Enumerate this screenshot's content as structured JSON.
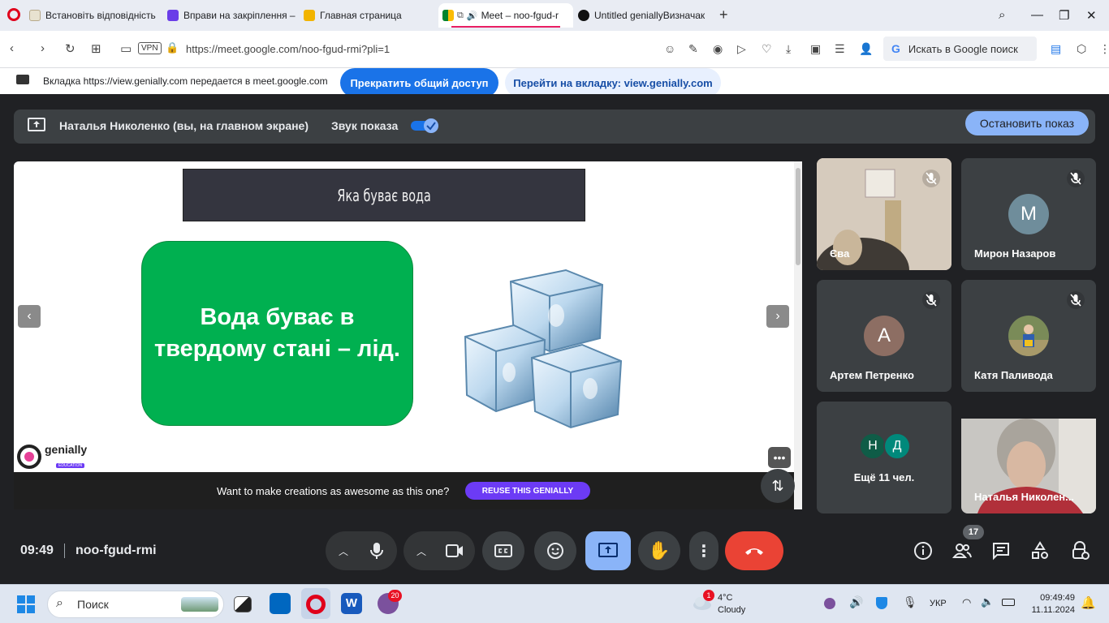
{
  "browser": {
    "tabs": [
      {
        "label": "Встановіть відповідність",
        "icon": "pencil-doc-icon"
      },
      {
        "label": "Вправи на закріплення –",
        "icon": "wordwall-icon"
      },
      {
        "label": "Главная страница",
        "icon": "profile-card-icon"
      },
      {
        "label": "Meet – noo-fgud-r",
        "icon": "meet-icon"
      },
      {
        "label": "Untitled geniallyВизначак",
        "icon": "genially-icon"
      }
    ],
    "url": "https://meet.google.com/noo-fgud-rmi?pli=1",
    "vpn_label": "VPN",
    "search_placeholder": "Искать в Google поиск"
  },
  "share_notice": {
    "text": "Вкладка https://view.genially.com передается в meet.google.com",
    "stop_button": "Прекратить общий доступ",
    "goto_button": "Перейти на вкладку: view.genially.com"
  },
  "presentation_bar": {
    "presenter": "Наталья Николенко (вы, на главном экране)",
    "sound_label": "Звук показа",
    "stop_button": "Остановить показ"
  },
  "slide": {
    "title": "Яка буває вода",
    "box_text_line1": "Вода буває в",
    "box_text_line2": "твердому стані – лід.",
    "logo_text": "genially",
    "logo_subtext": "EDUCATION",
    "reuse_text": "Want to make creations as awesome as this one?",
    "reuse_button": "REUSE THIS GENIALLY"
  },
  "participants": [
    {
      "name": "Єва",
      "type": "video"
    },
    {
      "name": "Мирон Назаров",
      "initial": "М",
      "color": "#6f8d9b"
    },
    {
      "name": "Артем Петренко",
      "initial": "А",
      "color": "#8d6e63"
    },
    {
      "name": "Катя Паливода",
      "type": "photo"
    },
    {
      "name": "Ещё 11 чел.",
      "initials": [
        "Н",
        "Д"
      ],
      "colors": [
        "#0f5c47",
        "#00897b"
      ]
    },
    {
      "name": "Наталья Николен...",
      "type": "video"
    }
  ],
  "meeting": {
    "time": "09:49",
    "code": "noo-fgud-rmi",
    "participants_count": "17"
  },
  "taskbar": {
    "search_label": "Поиск",
    "viber_badge": "20",
    "weather_badge": "1",
    "temperature": "4°C",
    "weather": "Cloudy",
    "lang": "УКР",
    "time": "09:49:49",
    "date": "11.11.2024"
  }
}
